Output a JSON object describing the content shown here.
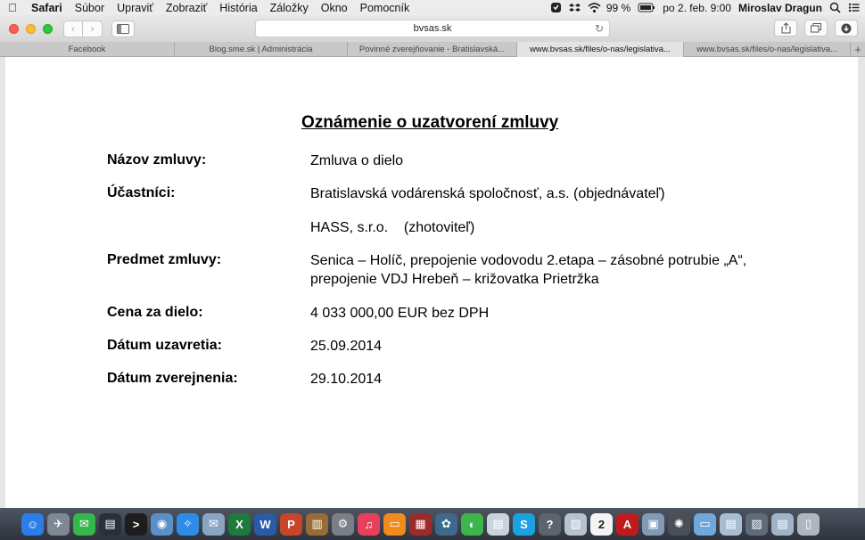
{
  "menubar": {
    "app": "Safari",
    "items": [
      "Súbor",
      "Upraviť",
      "Zobraziť",
      "História",
      "Záložky",
      "Okno",
      "Pomocník"
    ],
    "battery": "99 %",
    "clock": "po 2. feb.  9:00",
    "user": "Miroslav Dragun"
  },
  "toolbar": {
    "url": "bvsas.sk"
  },
  "tabs": [
    {
      "label": "Facebook",
      "active": false
    },
    {
      "label": "Blog.sme.sk | Administrácia",
      "active": false
    },
    {
      "label": "Povinné zverejňovanie - Bratislavská...",
      "active": false
    },
    {
      "label": "www.bvsas.sk/files/o-nas/legislativa...",
      "active": true
    },
    {
      "label": "www.bvsas.sk/files/o-nas/legislativa...",
      "active": false
    }
  ],
  "document": {
    "title": "Oznámenie o uzatvorení zmluvy",
    "rows": [
      {
        "label": "Názov zmluvy:",
        "value": "Zmluva o dielo"
      },
      {
        "label": "Účastníci:",
        "value": "Bratislavská vodárenská spoločnosť, a.s. (objednávateľ)"
      },
      {
        "label": "",
        "value": "HASS, s.r.o.    (zhotoviteľ)"
      },
      {
        "label": "Predmet zmluvy:",
        "value": "Senica – Holíč, prepojenie vodovodu 2.etapa – zásobné potrubie „A“, prepojenie VDJ Hrebeň – križovatka Prietržka"
      },
      {
        "label": "Cena za dielo:",
        "value": "4 033 000,00 EUR bez DPH"
      },
      {
        "label": "Dátum uzavretia:",
        "value": "25.09.2014"
      },
      {
        "label": "Dátum zverejnenia:",
        "value": "29.10.2014"
      }
    ]
  },
  "dock": {
    "icons": [
      {
        "name": "finder-icon",
        "color": "#2b7de9",
        "glyph": "☺"
      },
      {
        "name": "launchpad-icon",
        "color": "#7d8894",
        "glyph": "✈"
      },
      {
        "name": "messages-icon",
        "color": "#35b84a",
        "glyph": "✉"
      },
      {
        "name": "activity-monitor-icon",
        "color": "#26313b",
        "glyph": "▤"
      },
      {
        "name": "terminal-icon",
        "color": "#1d1d1d",
        "glyph": ">"
      },
      {
        "name": "preview-icon",
        "color": "#5a8fc8",
        "glyph": "◉"
      },
      {
        "name": "safari-icon",
        "color": "#2f8ce6",
        "glyph": "✧"
      },
      {
        "name": "mail-icon",
        "color": "#8aa5c2",
        "glyph": "✉"
      },
      {
        "name": "excel-icon",
        "color": "#1f7a3b",
        "glyph": "X"
      },
      {
        "name": "word-icon",
        "color": "#2a5ba8",
        "glyph": "W"
      },
      {
        "name": "powerpoint-icon",
        "color": "#c8452a",
        "glyph": "P"
      },
      {
        "name": "notes-icon",
        "color": "#9a6b33",
        "glyph": "▥"
      },
      {
        "name": "system-preferences-icon",
        "color": "#7a7f86",
        "glyph": "⚙"
      },
      {
        "name": "itunes-icon",
        "color": "#e8405a",
        "glyph": "♫"
      },
      {
        "name": "ibooks-icon",
        "color": "#f08b1c",
        "glyph": "▭"
      },
      {
        "name": "photo-booth-icon",
        "color": "#9b2b2b",
        "glyph": "▦"
      },
      {
        "name": "photos-icon",
        "color": "#3d6a8c",
        "glyph": "✿"
      },
      {
        "name": "facetime-icon",
        "color": "#3cb54a",
        "glyph": "◐"
      },
      {
        "name": "folder-stack-icon",
        "color": "#c9d3dd",
        "glyph": "▤"
      },
      {
        "name": "skype-icon",
        "color": "#1aa2e0",
        "glyph": "S"
      },
      {
        "name": "help-icon",
        "color": "#5c6470",
        "glyph": "?"
      },
      {
        "name": "image-capture-icon",
        "color": "#b6c2cf",
        "glyph": "▧"
      },
      {
        "name": "calendar-icon",
        "color": "#f4f4f4",
        "glyph": "2"
      },
      {
        "name": "acrobat-icon",
        "color": "#c01b1b",
        "glyph": "A"
      },
      {
        "name": "applications-icon",
        "color": "#7f9bb8",
        "glyph": "▣"
      },
      {
        "name": "settings-icon",
        "color": "#4a4f58",
        "glyph": "✺"
      },
      {
        "name": "documents-folder-icon",
        "color": "#6fa9dc",
        "glyph": "▭"
      },
      {
        "name": "downloads-icon",
        "color": "#a8bdd2",
        "glyph": "▤"
      },
      {
        "name": "screenshots-icon",
        "color": "#5f6b78",
        "glyph": "▨"
      },
      {
        "name": "document-icon",
        "color": "#9fb4c9",
        "glyph": "▤"
      },
      {
        "name": "trash-icon",
        "color": "#aeb6bf",
        "glyph": "▯"
      }
    ]
  }
}
